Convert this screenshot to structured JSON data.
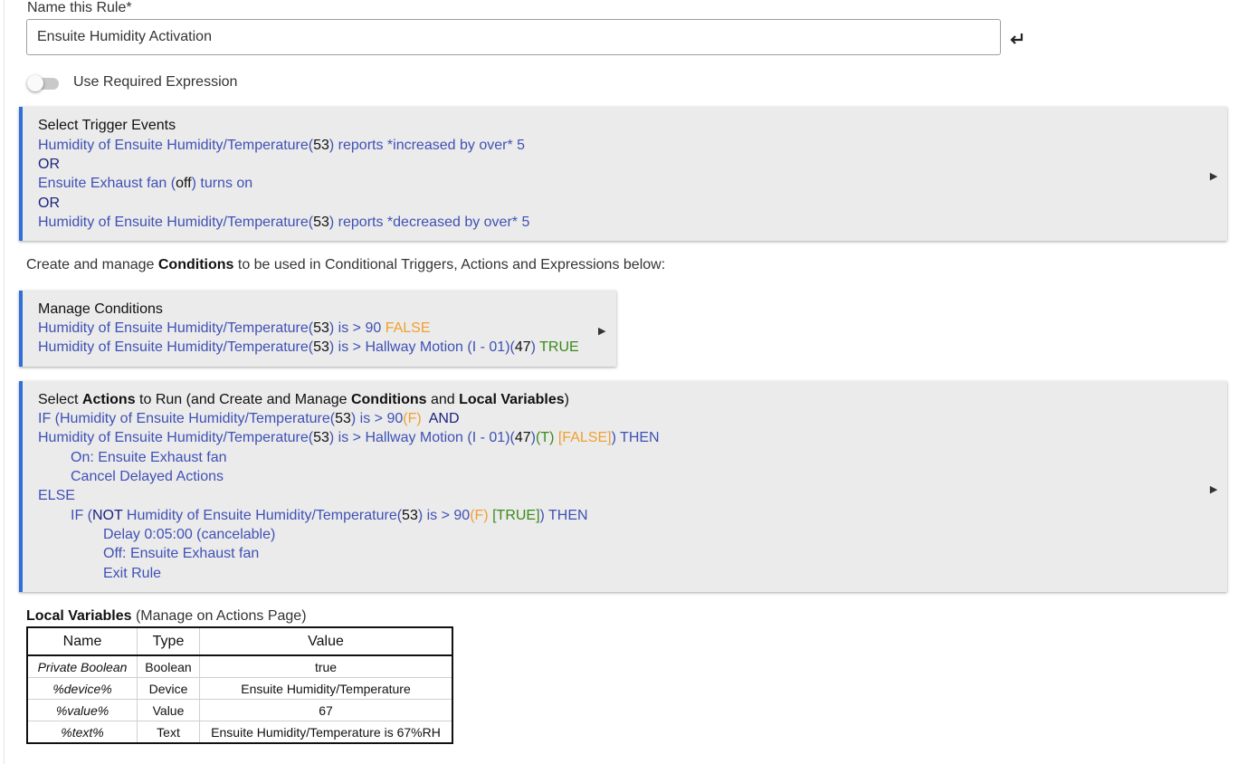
{
  "rule_name": {
    "label": "Name this Rule*",
    "value": "Ensuite Humidity Activation"
  },
  "required_expression": {
    "label": "Use Required Expression",
    "enabled": false
  },
  "triggers": {
    "header": "Select Trigger Events",
    "t1": {
      "a": "Humidity of Ensuite Humidity/Temperature(",
      "v": "53",
      "c": ") reports *increased by over* 5"
    },
    "or1": "OR",
    "t2": {
      "a": "Ensuite Exhaust fan (",
      "v": "off",
      "c": ") turns on"
    },
    "or2": "OR",
    "t3": {
      "a": "Humidity of Ensuite Humidity/Temperature(",
      "v": "53",
      "c": ") reports *decreased by over* 5"
    }
  },
  "conditions_text": {
    "pre": "Create and manage ",
    "bold": "Conditions",
    "post": " to be used in Conditional Triggers, Actions and Expressions below:"
  },
  "conditions": {
    "header": "Manage Conditions",
    "c1": {
      "a": "Humidity of Ensuite Humidity/Temperature(",
      "v": "53",
      "c": ") is > 90 ",
      "state": "FALSE"
    },
    "c2": {
      "a": "Humidity of Ensuite Humidity/Temperature(",
      "v": "53",
      "c": ") is > Hallway Motion (I - 01)(",
      "v2": "47",
      "d": ") ",
      "state": "TRUE"
    }
  },
  "actions": {
    "header": {
      "p1": "Select ",
      "b1": "Actions",
      "p2": " to Run (and Create and Manage ",
      "b2": "Conditions",
      "p3": " and ",
      "b3": "Local Variables",
      "p4": ")"
    },
    "l1": {
      "a": "IF (Humidity of Ensuite Humidity/Temperature(",
      "v": "53",
      "c": ") is > 90",
      "f": "(F)",
      "and": "  AND"
    },
    "l2": {
      "a": "Humidity of Ensuite Humidity/Temperature(",
      "v": "53",
      "c": ") is > Hallway Motion (I - 01)(",
      "v2": "47",
      "d": ")",
      "t": "(T)",
      "res": "[FALSE]",
      "e": ") THEN"
    },
    "l3": "On: Ensuite Exhaust fan",
    "l4": "Cancel Delayed Actions",
    "l5": "ELSE",
    "l6": {
      "a": "IF (",
      "not": "NOT",
      "b": " Humidity of Ensuite Humidity/Temperature(",
      "v": "53",
      "c": ") is > 90",
      "f": "(F)",
      "res": "[TRUE]",
      "e": ") THEN"
    },
    "l7": "Delay 0:05:00 (cancelable)",
    "l8": "Off: Ensuite Exhaust fan",
    "l9": "Exit Rule"
  },
  "local_variables": {
    "title": "Local Variables",
    "subtitle": " (Manage on Actions Page)",
    "columns": [
      "Name",
      "Type",
      "Value"
    ],
    "rows": [
      [
        "Private Boolean",
        "Boolean",
        "true"
      ],
      [
        "%device%",
        "Device",
        "Ensuite Humidity/Temperature"
      ],
      [
        "%value%",
        "Value",
        "67"
      ],
      [
        "%text%",
        "Text",
        "Ensuite Humidity/Temperature is 67%RH"
      ]
    ]
  },
  "colors": {
    "accent": "#2f6fd6",
    "link": "#3f51b5",
    "false": "#f0a030",
    "true": "#3a8a1a",
    "panel_bg": "#ebebeb"
  }
}
